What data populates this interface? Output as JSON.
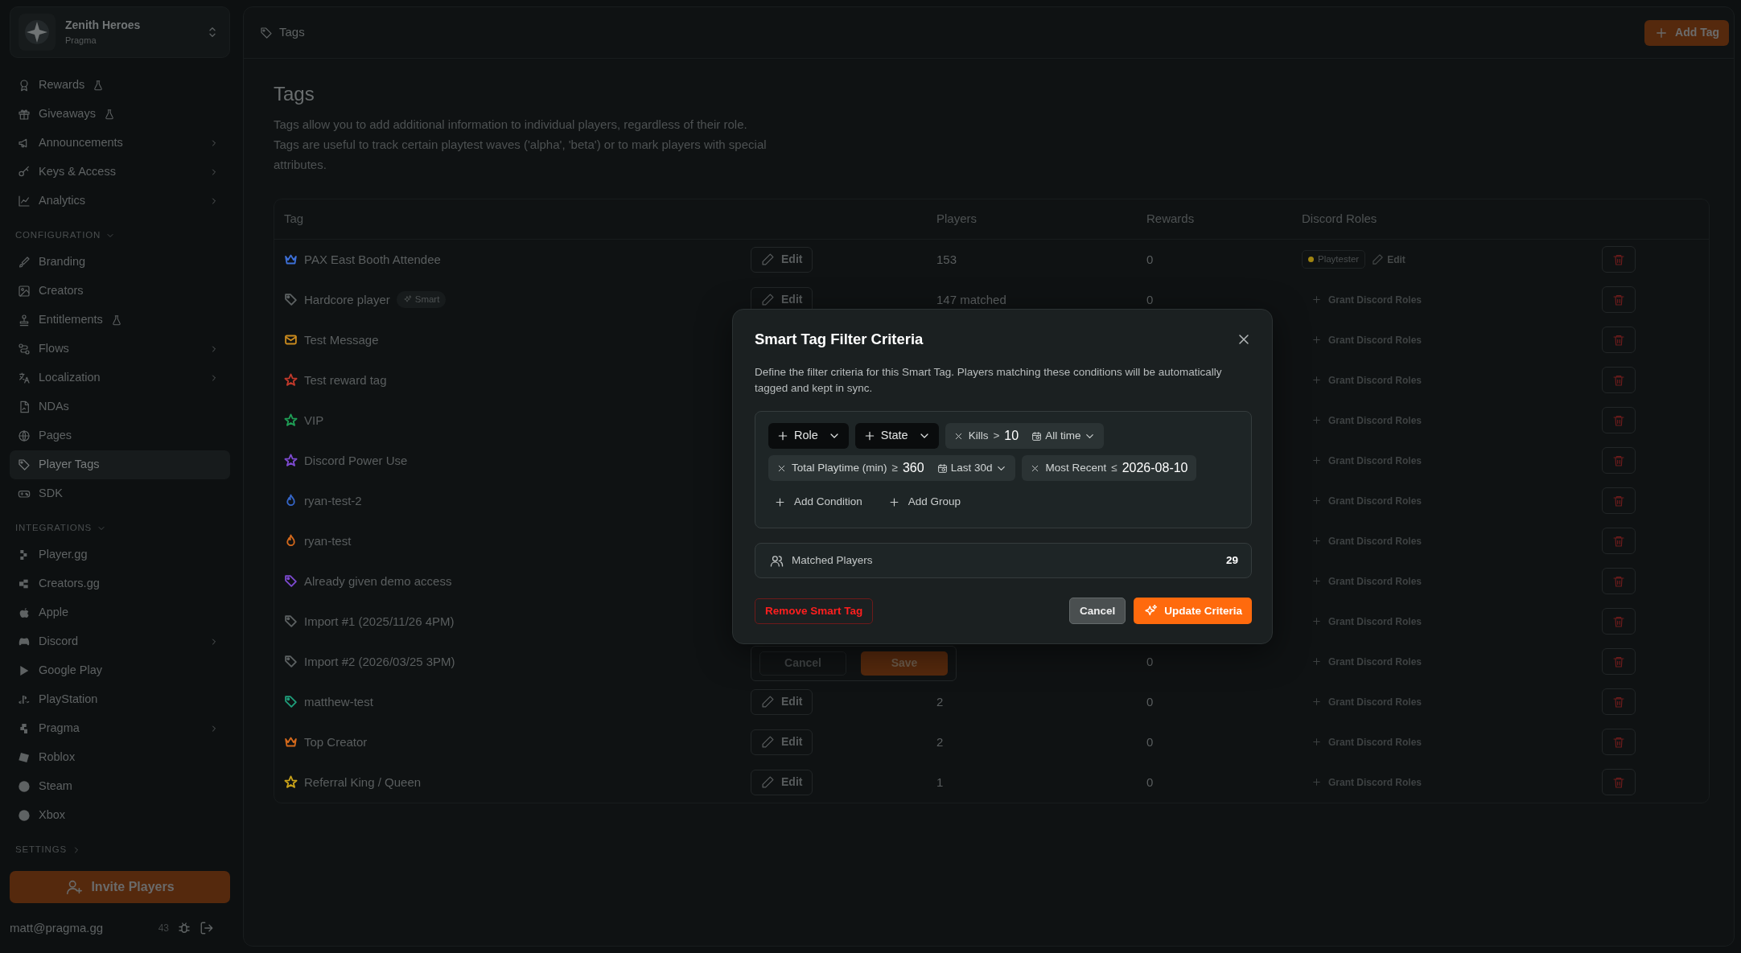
{
  "workspace": {
    "name": "Zenith Heroes",
    "org": "Pragma"
  },
  "sidebar": {
    "sections": [
      {
        "items": [
          {
            "label": "Rewards",
            "beta": true,
            "submenu": false,
            "selected": false
          },
          {
            "label": "Giveaways",
            "beta": true,
            "submenu": false,
            "selected": false
          },
          {
            "label": "Announcements",
            "beta": false,
            "submenu": true,
            "selected": false
          },
          {
            "label": "Keys & Access",
            "beta": false,
            "submenu": true,
            "selected": false
          },
          {
            "label": "Analytics",
            "beta": false,
            "submenu": true,
            "selected": false
          }
        ]
      },
      {
        "title": "CONFIGURATION",
        "expanded": true,
        "items": [
          {
            "label": "Branding",
            "beta": false,
            "submenu": false,
            "selected": false
          },
          {
            "label": "Creators",
            "beta": false,
            "submenu": false,
            "selected": false
          },
          {
            "label": "Entitlements",
            "beta": true,
            "submenu": false,
            "selected": false
          },
          {
            "label": "Flows",
            "beta": false,
            "submenu": true,
            "selected": false
          },
          {
            "label": "Localization",
            "beta": false,
            "submenu": true,
            "selected": false
          },
          {
            "label": "NDAs",
            "beta": false,
            "submenu": false,
            "selected": false
          },
          {
            "label": "Pages",
            "beta": false,
            "submenu": false,
            "selected": false
          },
          {
            "label": "Player Tags",
            "beta": false,
            "submenu": false,
            "selected": true
          },
          {
            "label": "SDK",
            "beta": false,
            "submenu": false,
            "selected": false
          }
        ]
      },
      {
        "title": "INTEGRATIONS",
        "expanded": true,
        "items": [
          {
            "label": "Player.gg",
            "beta": false,
            "submenu": false,
            "selected": false
          },
          {
            "label": "Creators.gg",
            "beta": false,
            "submenu": false,
            "selected": false
          },
          {
            "label": "Apple",
            "beta": false,
            "submenu": false,
            "selected": false
          },
          {
            "label": "Discord",
            "beta": false,
            "submenu": true,
            "selected": false
          },
          {
            "label": "Google Play",
            "beta": false,
            "submenu": false,
            "selected": false
          },
          {
            "label": "PlayStation",
            "beta": false,
            "submenu": false,
            "selected": false
          },
          {
            "label": "Pragma",
            "beta": false,
            "submenu": true,
            "selected": false
          },
          {
            "label": "Roblox",
            "beta": false,
            "submenu": false,
            "selected": false
          },
          {
            "label": "Steam",
            "beta": false,
            "submenu": false,
            "selected": false
          },
          {
            "label": "Xbox",
            "beta": false,
            "submenu": false,
            "selected": false
          }
        ]
      },
      {
        "title": "SETTINGS",
        "expanded": false
      }
    ]
  },
  "invite_button": "Invite Players",
  "user": {
    "email": "matt@pragma.gg",
    "count": "43"
  },
  "header": {
    "breadcrumb": "Tags",
    "add_button": "Add Tag"
  },
  "page": {
    "title": "Tags",
    "description": [
      "Tags allow you to add additional information to individual players, regardless of their role.",
      "Tags are useful to track certain playtest waves ('alpha', 'beta') or to mark players with special attributes."
    ]
  },
  "table": {
    "columns": [
      "Tag",
      "Players",
      "Rewards",
      "Discord Roles"
    ],
    "rows": [
      {
        "name": "PAX East Booth Attendee",
        "kind": "crown",
        "color": "#3d6fd6",
        "edit": "Edit",
        "players": "153",
        "rewards": "0",
        "roles": [
          {
            "label": "Playtester",
            "color": "#a08410"
          }
        ],
        "roles_edit": "Edit"
      },
      {
        "name": "Hardcore player",
        "kind": "tag",
        "color": "#5c6162",
        "badge": "Smart",
        "edit": "Edit",
        "players": "147 matched",
        "rewards": "0",
        "grant": "Grant Discord Roles"
      },
      {
        "name": "Test Message",
        "kind": "mail",
        "color": "#c98a1e",
        "grant": "Grant Discord Roles"
      },
      {
        "name": "Test reward tag",
        "kind": "star",
        "color": "#c0392b",
        "grant": "Grant Discord Roles"
      },
      {
        "name": "VIP",
        "kind": "star",
        "color": "#1f9d55",
        "grant": "Grant Discord Roles"
      },
      {
        "name": "Discord Power Use",
        "kind": "star",
        "color": "#7d4ad0",
        "grant": "Grant Discord Roles"
      },
      {
        "name": "ryan-test-2",
        "kind": "flame",
        "color": "#3566c8",
        "grant": "Grant Discord Roles"
      },
      {
        "name": "ryan-test",
        "kind": "flame",
        "color": "#d4691c",
        "grant": "Grant Discord Roles"
      },
      {
        "name": "Already given demo access",
        "kind": "tag",
        "color": "#7d4ad0",
        "grant": "Grant Discord Roles"
      },
      {
        "name": "Import #1 (2025/11/26 4PM)",
        "kind": "tag",
        "color": "#5c6162",
        "grant": "Grant Discord Roles"
      },
      {
        "name": "Import #2 (2026/03/25 3PM)",
        "kind": "tag",
        "color": "#5c6162",
        "edit_actions": [
          "Cancel",
          "Save"
        ],
        "rewards": "0",
        "grant": "Grant Discord Roles"
      },
      {
        "name": "matthew-test",
        "kind": "tag",
        "color": "#1f9d7a",
        "edit": "Edit",
        "players": "2",
        "rewards": "0",
        "grant": "Grant Discord Roles"
      },
      {
        "name": "Top Creator",
        "kind": "crown",
        "color": "#d4691c",
        "edit": "Edit",
        "players": "2",
        "rewards": "0",
        "grant": "Grant Discord Roles"
      },
      {
        "name": "Referral King / Queen",
        "kind": "star",
        "color": "#c9a21a",
        "edit": "Edit",
        "players": "1",
        "rewards": "0",
        "grant": "Grant Discord Roles"
      }
    ]
  },
  "dialog": {
    "title": "Smart Tag Filter Criteria",
    "description": "Define the filter criteria for this Smart Tag. Players matching these conditions will be automatically tagged and kept in sync.",
    "filters": [
      {
        "kind": "select",
        "label": "Role"
      },
      {
        "kind": "select",
        "label": "State"
      },
      {
        "kind": "condition",
        "field": "Kills",
        "operator": ">",
        "value": "10",
        "period": "All time"
      },
      {
        "kind": "condition",
        "field": "Total Playtime (min)",
        "operator": "≥",
        "value": "360",
        "period": "Last 30d"
      },
      {
        "kind": "condition",
        "field": "Most Recent",
        "operator": "≤",
        "value": "2026-08-10"
      }
    ],
    "add_actions": [
      "Add Condition",
      "Add Group"
    ],
    "matched": {
      "label": "Matched Players",
      "count": "29"
    },
    "remove_button": "Remove Smart Tag",
    "cancel_button": "Cancel",
    "submit_button": "Update Criteria"
  }
}
